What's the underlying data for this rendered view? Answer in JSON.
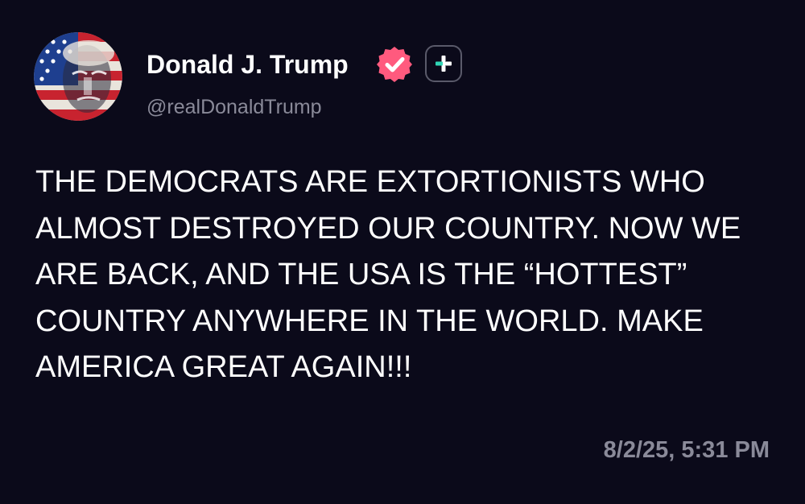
{
  "post": {
    "author": {
      "display_name": "Donald J. Trump",
      "handle": "@realDonaldTrump",
      "avatar_icon": "avatar-portrait-flag",
      "verified_icon": "verified-badge-icon",
      "plus_icon": "plus-badge-icon"
    },
    "text": "THE DEMOCRATS ARE EXTORTIONISTS WHO\nALMOST DESTROYED OUR COUNTRY. NOW WE\nARE BACK, AND THE USA IS THE “HOTTEST”\nCOUNTRY ANYWHERE IN THE WORLD. MAKE\nAMERICA GREAT AGAIN!!!",
    "timestamp": "8/2/25, 5:31 PM"
  },
  "colors": {
    "background": "#0b0a1a",
    "text_primary": "#ffffff",
    "text_secondary": "#8a8a99",
    "verified_badge": "#ff5a7e",
    "plus_accent": "#2fd4b4"
  }
}
